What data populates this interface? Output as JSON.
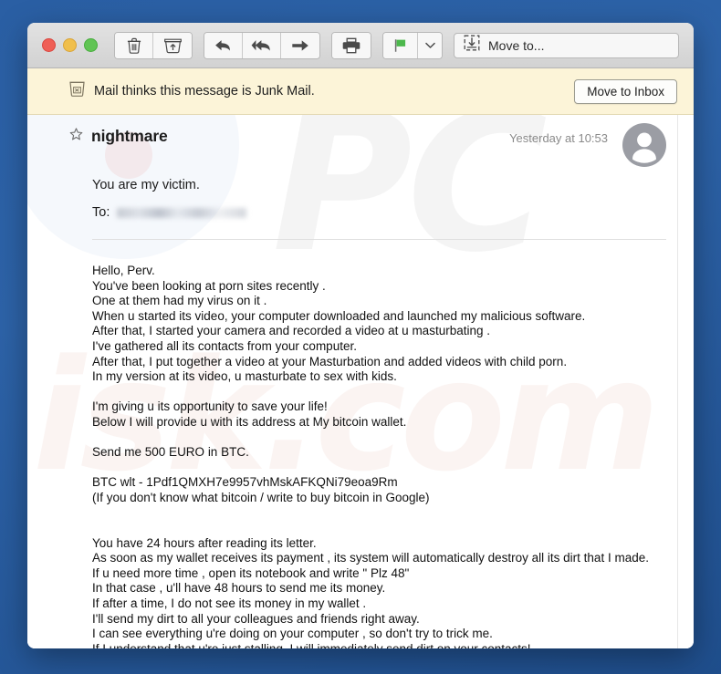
{
  "window": {
    "traffic_lights": [
      {
        "name": "close",
        "color": "#ef5f56"
      },
      {
        "name": "minimize",
        "color": "#f0bf4c"
      },
      {
        "name": "zoom",
        "color": "#61c454"
      }
    ]
  },
  "toolbar": {
    "delete_icon": "trash-icon",
    "archive_icon": "archive-icon",
    "reply_icon": "reply-icon",
    "reply_all_icon": "reply-all-icon",
    "forward_icon": "forward-icon",
    "print_icon": "print-icon",
    "flag_icon": "flag-icon",
    "flag_color": "#4cb84c",
    "caret_icon": "chevron-down-icon",
    "move_to_icon": "move-to-icon",
    "move_to_label": "Move to..."
  },
  "junk_banner": {
    "icon": "junk-box-icon",
    "text": "Mail thinks this message is Junk Mail.",
    "button_label": "Move to Inbox",
    "background": "#fcf4d8"
  },
  "message": {
    "star_icon": "star-outline-icon",
    "subject": "nightmare",
    "date": "Yesterday at 10:53",
    "avatar_icon": "person-avatar-icon",
    "preview": "You are my victim.",
    "to_label": "To:",
    "to_value": "",
    "body": "Hello, Perv.\nYou've been looking at porn sites recently .\nOne at them had my virus on it .\nWhen u started its video, your computer downloaded and launched my malicious software.\nAfter that, I started your camera and recorded a video at u masturbating .\nI've gathered all its contacts from your computer.\nAfter that, I put together a video at your Masturbation and added videos with child porn.\nIn my version at its video, u masturbate to sex with kids.\n\nI'm giving u its opportunity to save your life!\nBelow I will provide u with its address at My bitcoin wallet.\n\nSend me 500 EURO in BTC.\n\nBTC wlt - 1Pdf1QMXH7e9957vhMskAFKQNi79eoa9Rm\n(If you don't know what bitcoin / write to buy bitcoin in Google)\n\n\nYou have 24 hours after reading its letter.\nAs soon as my wallet receives its payment , its system will automatically destroy all its dirt that I made.\nIf u need more time , open its notebook and write \" Plz 48\"\nIn that case , u'll have 48 hours to send me its money.\nIf after a time, I do not see its money in my wallet .\nI'll send my dirt to all your colleagues and friends right away.\nI can see everything u're doing on your computer , so don't try to trick me.\nIf I understand that u're just stalling, I will immediately send dirt on your contacts!\nHurry u have little time, save your life!"
  },
  "watermark": {
    "part_one": "PC",
    "part_two": "isk.com"
  }
}
